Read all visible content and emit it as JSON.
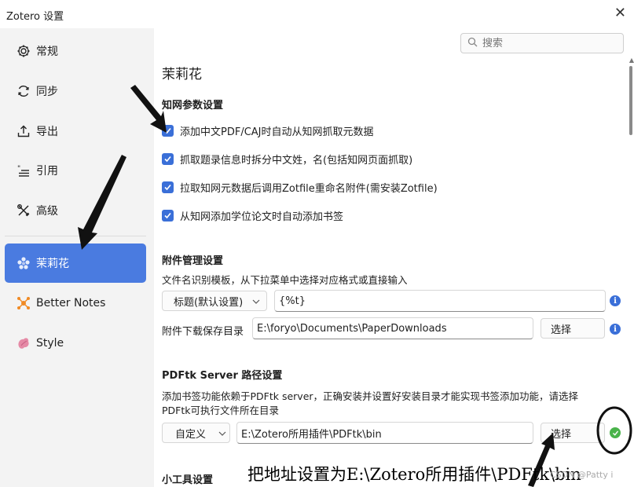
{
  "window": {
    "title": "Zotero 设置",
    "close_glyph": "✕"
  },
  "sidebar": {
    "items": [
      {
        "label": "常规",
        "icon": "gear-icon"
      },
      {
        "label": "同步",
        "icon": "sync-icon"
      },
      {
        "label": "导出",
        "icon": "export-icon"
      },
      {
        "label": "引用",
        "icon": "cite-icon"
      },
      {
        "label": "高级",
        "icon": "tools-icon"
      },
      {
        "label": "茉莉花",
        "icon": "jasmine-icon",
        "active": true
      },
      {
        "label": "Better Notes",
        "icon": "better-notes-icon"
      },
      {
        "label": "Style",
        "icon": "style-icon"
      }
    ]
  },
  "search": {
    "placeholder": "搜索"
  },
  "page": {
    "title": "茉莉花",
    "cnki": {
      "heading": "知网参数设置",
      "options": [
        {
          "label": "添加中文PDF/CAJ时自动从知网抓取元数据",
          "checked": true
        },
        {
          "label": "抓取题录信息时拆分中文姓，名(包括知网页面抓取)",
          "checked": true
        },
        {
          "label": "拉取知网元数据后调用Zotfile重命名附件(需安装Zotfile)",
          "checked": true
        },
        {
          "label": "从知网添加学位论文时自动添加书签",
          "checked": true
        }
      ]
    },
    "attachments": {
      "heading": "附件管理设置",
      "desc": "文件名识别模板，从下拉菜单中选择对应格式或直接输入",
      "template_select": "标题(默认设置)",
      "template_value": "{%t}",
      "download_label": "附件下载保存目录",
      "download_path": "E:\\foryo\\Documents\\PaperDownloads",
      "choose_label": "选择"
    },
    "pdftk": {
      "heading": "PDFtk Server 路径设置",
      "desc_line1": "添加书签功能依赖于PDFtk server，正确安装并设置好安装目录才能实现书签添加功能，请选择",
      "desc_line2": "PDFtk可执行文件所在目录",
      "mode_select": "自定义",
      "path": "E:\\Zotero所用插件\\PDFtk\\bin",
      "choose_label": "选择"
    },
    "tools": {
      "heading": "小工具设置"
    }
  },
  "annotation": {
    "text": "把地址设置为E:\\Zotero所用插件\\PDFtk\\bin",
    "watermark": "CSDN @Patty i"
  },
  "colors": {
    "accent": "#4a7be0",
    "checkbox": "#3a6fd8",
    "ok": "#49b34a"
  }
}
